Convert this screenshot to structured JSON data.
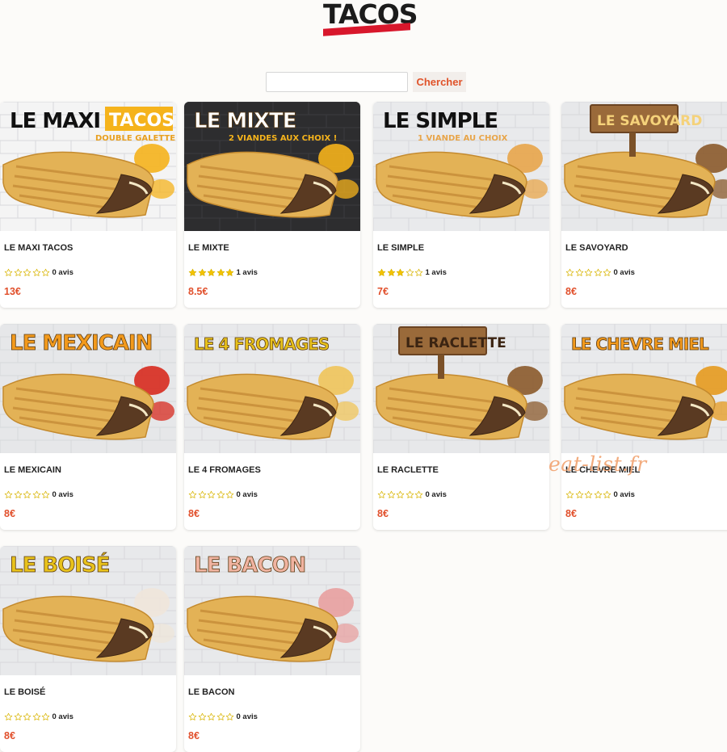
{
  "header": {
    "logo_text": "TACOS",
    "logo_color": "#d8172c"
  },
  "search": {
    "placeholder": "",
    "value": "",
    "button_label": "Chercher"
  },
  "products": [
    {
      "title": "LE MAXI TACOS",
      "banner": "LE MAXI TACOS",
      "subtitle": "DOUBLE GALETTE !",
      "rating": 0,
      "reviews": "0 avis",
      "price": "13€",
      "bg": "#f4f4f4",
      "banner_color": "#111111",
      "accent": "#f5b31c"
    },
    {
      "title": "LE MIXTE",
      "banner": "LE MIXTE",
      "subtitle": "2 VIANDES AUX CHOIX !",
      "rating": 5,
      "reviews": "1 avis",
      "price": "8.5€",
      "bg": "#2d2d2f",
      "banner_color": "#ffffff",
      "accent": "#f5b31c"
    },
    {
      "title": "LE SIMPLE",
      "banner": "LE SIMPLE",
      "subtitle": "1 VIANDE AU CHOIX",
      "rating": 3,
      "reviews": "1 avis",
      "price": "7€",
      "bg": "#e9eaec",
      "banner_color": "#111111",
      "accent": "#e8a54a"
    },
    {
      "title": "LE SAVOYARD",
      "banner": "LE SAVOYARD",
      "subtitle": "",
      "rating": 0,
      "reviews": "0 avis",
      "price": "8€",
      "bg": "#e7e8ea",
      "banner_color": "#f5d27a",
      "accent": "#8b5a2b"
    },
    {
      "title": "LE MEXICAIN",
      "banner": "LE MEXICAIN",
      "subtitle": "",
      "rating": 0,
      "reviews": "0 avis",
      "price": "8€",
      "bg": "#e6e7e9",
      "banner_color": "#f39a1c",
      "accent": "#d72a1e"
    },
    {
      "title": "LE 4 FROMAGES",
      "banner": "LE 4 FROMAGES",
      "subtitle": "",
      "rating": 0,
      "reviews": "0 avis",
      "price": "8€",
      "bg": "#e8e9eb",
      "banner_color": "#e8c21b",
      "accent": "#f0c45a"
    },
    {
      "title": "LE RACLETTE",
      "banner": "LE RACLETTE",
      "subtitle": "",
      "rating": 0,
      "reviews": "0 avis",
      "price": "8€",
      "bg": "#e7e8ea",
      "banner_color": "#3b2412",
      "accent": "#8b5a2b"
    },
    {
      "title": "LE CHEVRE MIEL",
      "banner": "LE CHEVRE MIEL",
      "subtitle": "",
      "rating": 0,
      "reviews": "0 avis",
      "price": "8€",
      "bg": "#e9eaec",
      "banner_color": "#f39a1c",
      "accent": "#e59a1e"
    },
    {
      "title": "LE BOISÉ",
      "banner": "LE BOISÉ",
      "subtitle": "",
      "rating": 0,
      "reviews": "0 avis",
      "price": "8€",
      "bg": "#e8e9eb",
      "banner_color": "#e8c21b",
      "accent": "#efe6da"
    },
    {
      "title": "LE BACON",
      "banner": "LE BACON",
      "subtitle": "",
      "rating": 0,
      "reviews": "0 avis",
      "price": "8€",
      "bg": "#e8e9eb",
      "banner_color": "#f0b3a0",
      "accent": "#e8a0a0"
    }
  ],
  "watermark": "eat-list.fr",
  "colors": {
    "price": "#e1502c",
    "star_filled": "#f5c300",
    "star_outline": "#d8b400"
  }
}
